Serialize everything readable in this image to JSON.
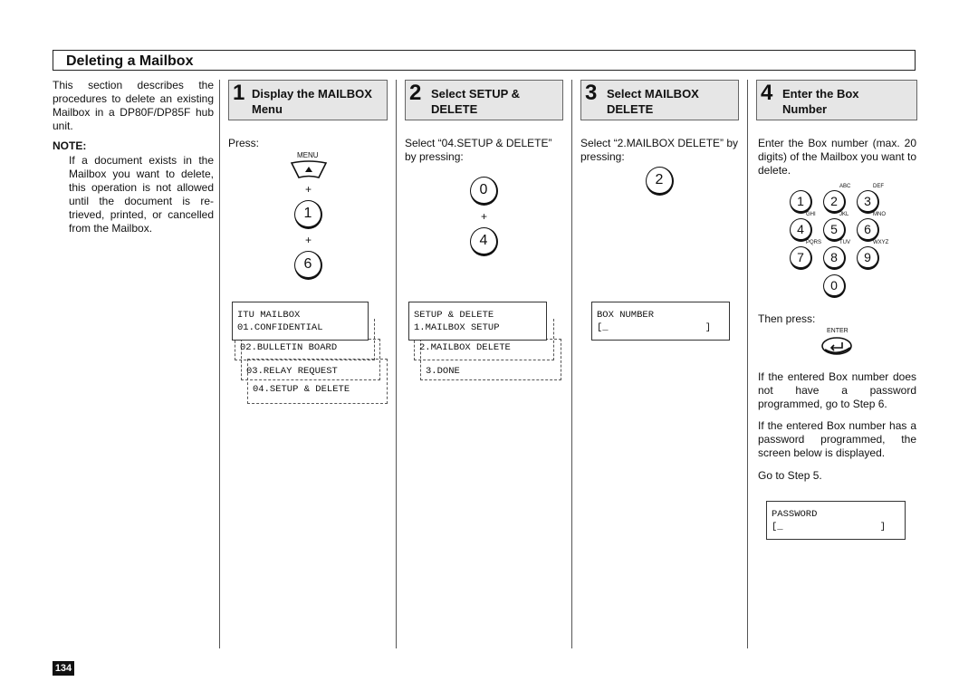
{
  "title": "Deleting a Mailbox",
  "intro": "This section describes the procedures to delete an existing Mailbox in a DP80F/DP85F hub unit.",
  "note": {
    "heading": "NOTE:",
    "text": "If a document exists in the Mailbox you want to delete, this operation is not allowed until the document is re-trieved, printed, or cancelled from the Mailbox."
  },
  "steps": [
    {
      "num": "1",
      "label": "Display the MAILBOX Menu"
    },
    {
      "num": "2",
      "label": "Select SETUP & DELETE"
    },
    {
      "num": "3",
      "label": "Select  MAILBOX DELETE"
    },
    {
      "num": "4",
      "label": "Enter the Box Number"
    }
  ],
  "step1": {
    "text": "Press:",
    "menu_label": "MENU",
    "plus": "+",
    "keys": [
      "1",
      "6"
    ],
    "lcd": [
      "ITU MAILBOX",
      "01.CONFIDENTIAL"
    ],
    "menu": [
      "02.BULLETIN BOARD",
      "03.RELAY REQUEST",
      "04.SETUP & DELETE"
    ]
  },
  "step2": {
    "text": "Select “04.SETUP & DELETE” by pressing:",
    "plus": "+",
    "keys": [
      "0",
      "4"
    ],
    "lcd": [
      "SETUP & DELETE",
      "1.MAILBOX SETUP"
    ],
    "menu": [
      "2.MAILBOX DELETE",
      "3.DONE"
    ]
  },
  "step3": {
    "text": "Select “2.MAILBOX DELETE” by pressing:",
    "key": "2",
    "lcd": [
      "BOX NUMBER",
      "[_                 ]"
    ]
  },
  "step4": {
    "text": "Enter the Box number (max. 20 digits) of the Mailbox you want to delete.",
    "keypad": [
      {
        "k": "1",
        "s": ""
      },
      {
        "k": "2",
        "s": "ABC"
      },
      {
        "k": "3",
        "s": "DEF"
      },
      {
        "k": "4",
        "s": "GHI"
      },
      {
        "k": "5",
        "s": "JKL"
      },
      {
        "k": "6",
        "s": "MNO"
      },
      {
        "k": "7",
        "s": "PQRS"
      },
      {
        "k": "8",
        "s": "TUV"
      },
      {
        "k": "9",
        "s": "WXYZ"
      },
      {
        "k": "0",
        "s": ""
      }
    ],
    "then": "Then press:",
    "enter_label": "ENTER",
    "p1": "If the entered Box number does not have a password programmed, go to Step 6.",
    "p2": "If the entered Box number has a password programmed, the screen below is displayed.",
    "p3": "Go to Step 5.",
    "lcd": [
      "PASSWORD",
      "[_                 ]"
    ]
  },
  "page_number": "134"
}
